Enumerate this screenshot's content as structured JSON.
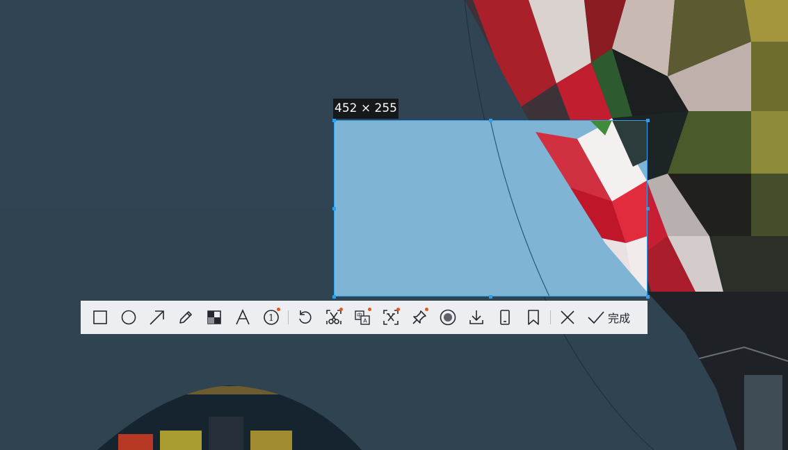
{
  "selection": {
    "size_label": "452 × 255",
    "accent_color": "#2aa0ee"
  },
  "toolbar": {
    "tools": [
      {
        "name": "rectangle-tool",
        "icon": "square-icon",
        "badge": false
      },
      {
        "name": "ellipse-tool",
        "icon": "circle-icon",
        "badge": false
      },
      {
        "name": "arrow-tool",
        "icon": "arrow-icon",
        "badge": false
      },
      {
        "name": "pen-tool",
        "icon": "pencil-icon",
        "badge": false
      },
      {
        "name": "mosaic-tool",
        "icon": "mosaic-icon",
        "badge": false
      },
      {
        "name": "text-tool",
        "icon": "text-icon",
        "badge": false
      },
      {
        "name": "number-marker-tool",
        "icon": "numbered-circle-icon",
        "badge": true,
        "badge_text": "1"
      },
      {
        "name": "undo-button",
        "icon": "undo-icon",
        "badge": false
      },
      {
        "name": "cutout-tool",
        "icon": "scissors-icon",
        "badge": true
      },
      {
        "name": "translate-tool",
        "icon": "translate-icon",
        "badge": true
      },
      {
        "name": "ocr-tool",
        "icon": "ocr-icon",
        "badge": true
      },
      {
        "name": "pin-tool",
        "icon": "pin-icon",
        "badge": true
      },
      {
        "name": "record-button",
        "icon": "record-icon",
        "badge": false
      },
      {
        "name": "save-button",
        "icon": "download-icon",
        "badge": false
      },
      {
        "name": "send-to-phone-button",
        "icon": "phone-icon",
        "badge": false
      },
      {
        "name": "bookmark-button",
        "icon": "bookmark-icon",
        "badge": false
      },
      {
        "name": "cancel-button",
        "icon": "close-icon",
        "badge": false
      }
    ],
    "done_label": "完成",
    "badge_color": "#e3561d"
  }
}
